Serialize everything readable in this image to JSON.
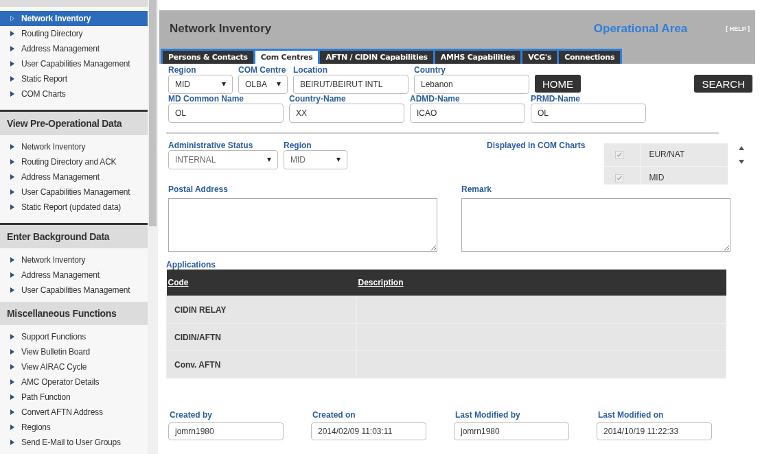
{
  "sidebar": {
    "sections": [
      {
        "items": [
          {
            "label": "Network Inventory",
            "selected": true
          },
          {
            "label": "Routing Directory",
            "selected": false
          },
          {
            "label": "Address Management",
            "selected": false
          },
          {
            "label": "User Capabilities Management",
            "selected": false
          },
          {
            "label": "Static Report",
            "selected": false
          },
          {
            "label": "COM Charts",
            "selected": false
          }
        ]
      },
      {
        "title": "View Pre-Operational Data",
        "items": [
          {
            "label": "Network Inventory",
            "selected": false
          },
          {
            "label": "Routing Directory and ACK",
            "selected": false
          },
          {
            "label": "Address Management",
            "selected": false
          },
          {
            "label": "User Capabilities Management",
            "selected": false
          },
          {
            "label": "Static Report (updated data)",
            "selected": false
          }
        ]
      },
      {
        "title": "Enter Background Data",
        "items": [
          {
            "label": "Network Inventory",
            "selected": false
          },
          {
            "label": "Address Management",
            "selected": false
          },
          {
            "label": "User Capabilities Management",
            "selected": false
          }
        ]
      },
      {
        "title": "Miscellaneous Functions",
        "items": [
          {
            "label": "Support Functions",
            "selected": false
          },
          {
            "label": "View Bulletin Board",
            "selected": false
          },
          {
            "label": "View AIRAC Cycle",
            "selected": false
          },
          {
            "label": "AMC Operator Details",
            "selected": false
          },
          {
            "label": "Path Function",
            "selected": false
          },
          {
            "label": "Convert AFTN Address",
            "selected": false
          },
          {
            "label": "Regions",
            "selected": false
          },
          {
            "label": "Send E-Mail to User Groups",
            "selected": false
          }
        ]
      }
    ]
  },
  "header": {
    "title": "Network Inventory",
    "area": "Operational Area",
    "help": "[ HELP ]"
  },
  "tabs": [
    {
      "label": "Persons & Contacts",
      "selected": false
    },
    {
      "label": "Com Centres",
      "selected": true
    },
    {
      "label": "AFTN / CIDIN Capabilities",
      "selected": false
    },
    {
      "label": "AMHS Capabilities",
      "selected": false
    },
    {
      "label": "VCG's",
      "selected": false
    },
    {
      "label": "Connections",
      "selected": false
    }
  ],
  "form": {
    "region": {
      "label": "Region",
      "value": "MID"
    },
    "com_centre": {
      "label": "COM Centre",
      "value": "OLBA"
    },
    "location": {
      "label": "Location",
      "value": "BEIRUT/BEIRUT INTL"
    },
    "country": {
      "label": "Country",
      "value": "Lebanon"
    },
    "home_button": "HOME",
    "search_button": "SEARCH",
    "md_common_name": {
      "label": "MD Common Name",
      "value": "OL"
    },
    "country_name": {
      "label": "Country-Name",
      "value": "XX"
    },
    "admd_name": {
      "label": "ADMD-Name",
      "value": "ICAO"
    },
    "prmd_name": {
      "label": "PRMD-Name",
      "value": "OL"
    },
    "admin_status": {
      "label": "Administrative Status",
      "value": "INTERNAL"
    },
    "status_region": {
      "label": "Region",
      "value": "MID"
    },
    "com_charts": {
      "label": "Displayed in COM Charts",
      "items": [
        {
          "label": "EUR/NAT",
          "checked": true
        },
        {
          "label": "MID",
          "checked": true
        }
      ]
    },
    "postal_address": {
      "label": "Postal Address"
    },
    "remark": {
      "label": "Remark"
    }
  },
  "applications": {
    "title": "Applications",
    "columns": [
      "Code",
      "Description"
    ],
    "rows": [
      [
        "CIDIN RELAY",
        ""
      ],
      [
        "CIDIN/AFTN",
        ""
      ],
      [
        "Conv. AFTN",
        ""
      ]
    ]
  },
  "audit": [
    {
      "label": "Created by",
      "value": "jomrn1980"
    },
    {
      "label": "Created on",
      "value": "2014/02/09 11:03:11"
    },
    {
      "label": "Last Modified by",
      "value": "jomrn1980"
    },
    {
      "label": "Last Modified on",
      "value": "2014/10/19 11:22:33"
    }
  ]
}
